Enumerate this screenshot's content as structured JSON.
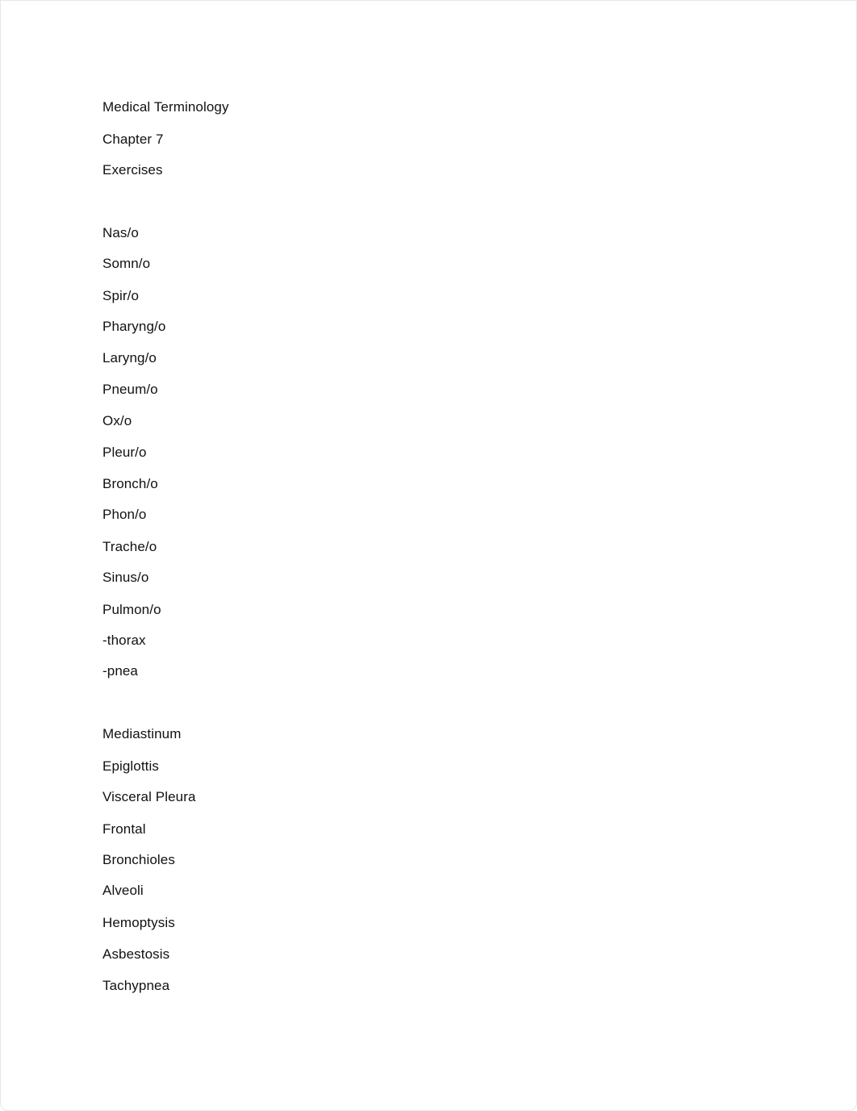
{
  "document": {
    "header": {
      "title": "Medical Terminology",
      "chapter": "Chapter 7",
      "section": "Exercises"
    },
    "word_parts": [
      "Nas/o",
      "Somn/o",
      "Spir/o",
      "Pharyng/o",
      "Laryng/o",
      "Pneum/o",
      "Ox/o",
      "Pleur/o",
      "Bronch/o",
      "Phon/o",
      "Trache/o",
      "Sinus/o",
      "Pulmon/o",
      "-thorax",
      "-pnea"
    ],
    "terms": [
      "Mediastinum",
      "Epiglottis",
      "Visceral Pleura",
      "Frontal",
      "Bronchioles",
      "Alveoli",
      "Hemoptysis",
      "Asbestosis",
      "Tachypnea"
    ]
  }
}
